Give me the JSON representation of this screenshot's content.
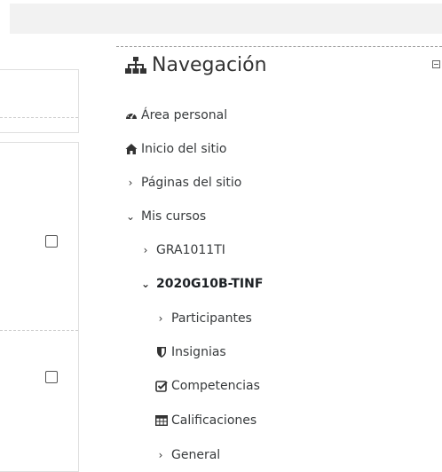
{
  "navigation": {
    "title": "Navegación",
    "items": [
      {
        "label": "Área personal",
        "icon": "dashboard-icon"
      },
      {
        "label": "Inicio del sitio",
        "icon": "home-icon"
      },
      {
        "label": "Páginas del sitio",
        "icon": "chevron-right-icon"
      },
      {
        "label": "Mis cursos",
        "icon": "chevron-down-icon"
      },
      {
        "label": "GRA1011TI",
        "icon": "chevron-right-icon"
      },
      {
        "label": "2020G10B-TINF",
        "icon": "chevron-down-icon"
      },
      {
        "label": "Participantes",
        "icon": "chevron-right-icon"
      },
      {
        "label": "Insignias",
        "icon": "shield-icon"
      },
      {
        "label": "Competencias",
        "icon": "checkbox-icon"
      },
      {
        "label": "Calificaciones",
        "icon": "table-icon"
      },
      {
        "label": "General",
        "icon": "chevron-right-icon"
      }
    ]
  }
}
